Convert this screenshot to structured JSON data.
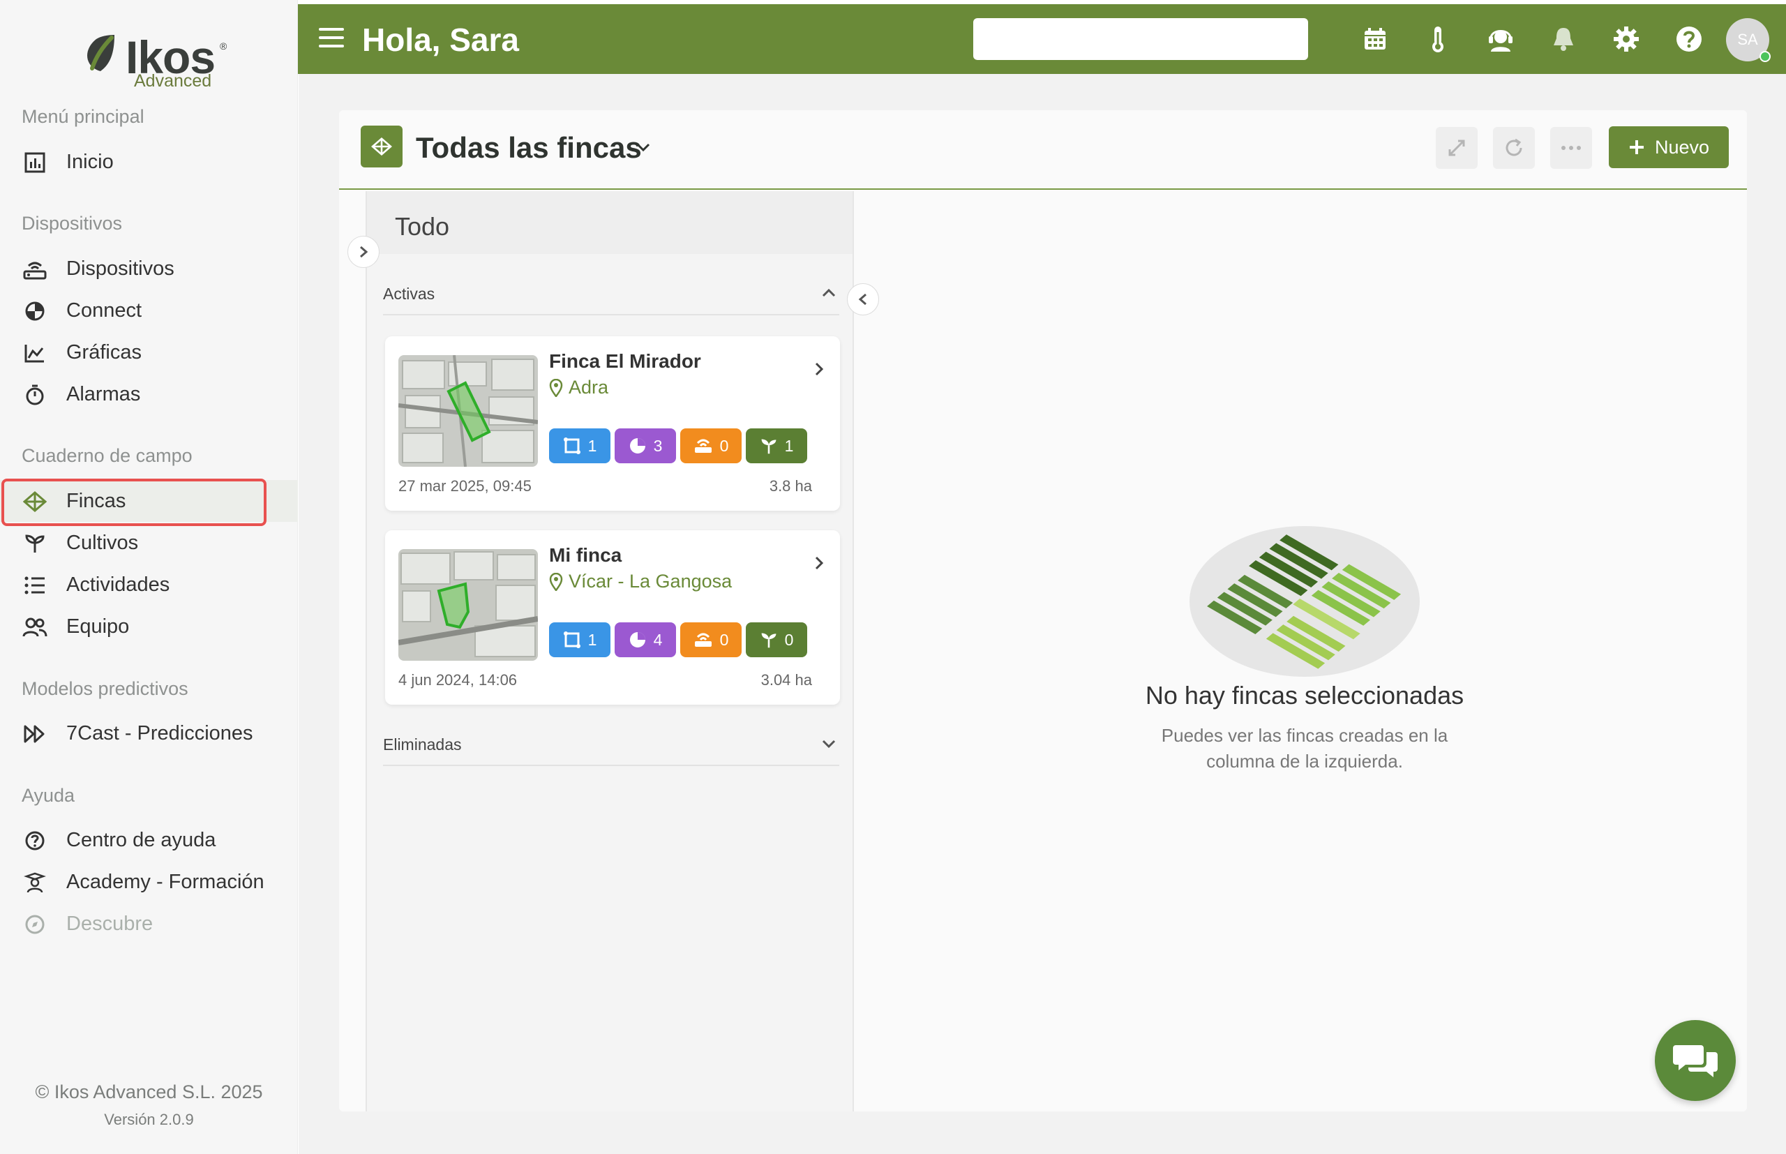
{
  "brand": {
    "name": "Ikos",
    "sub": "Advanced",
    "reg": "®",
    "accent": "#6a8a38",
    "highlight": "#e8514f"
  },
  "header": {
    "greeting": "Hola, Sara",
    "search_placeholder": "",
    "avatar_initials": "SA",
    "icons": [
      "calendar-icon",
      "thermometer-icon",
      "support-agent-icon",
      "bell-icon",
      "gear-icon",
      "help-icon"
    ]
  },
  "sidebar": {
    "sections": {
      "main": "Menú principal",
      "devices": "Dispositivos",
      "fieldbook": "Cuaderno de campo",
      "predictive": "Modelos predictivos",
      "help": "Ayuda"
    },
    "items": {
      "inicio": "Inicio",
      "dispositivos": "Dispositivos",
      "connect": "Connect",
      "graficas": "Gráficas",
      "alarmas": "Alarmas",
      "fincas": "Fincas",
      "cultivos": "Cultivos",
      "actividades": "Actividades",
      "equipo": "Equipo",
      "sevencast": "7Cast - Predicciones",
      "centro": "Centro de ayuda",
      "academy": "Academy - Formación",
      "descubre": "Descubre"
    },
    "active_item": "Fincas",
    "footer": {
      "copyright": "© Ikos Advanced S.L. 2025",
      "version": "Versión 2.0.9"
    }
  },
  "panel": {
    "title": "Todas las fincas",
    "new_button": "Nuevo",
    "list_title": "Todo",
    "group_active": "Activas",
    "group_deleted": "Eliminadas",
    "farms": [
      {
        "name": "Finca El Mirador",
        "location": "Adra",
        "badges": {
          "fields": "1",
          "sectors": "3",
          "devices": "0",
          "crops": "1"
        },
        "date": "27 mar 2025, 09:45",
        "area": "3.8 ha"
      },
      {
        "name": "Mi finca",
        "location": "Vícar - La Gangosa",
        "badges": {
          "fields": "1",
          "sectors": "4",
          "devices": "0",
          "crops": "0"
        },
        "date": "4 jun 2024, 14:06",
        "area": "3.04 ha"
      }
    ],
    "empty": {
      "title": "No hay fincas seleccionadas",
      "subtitle_line1": "Puedes ver las fincas creadas en la",
      "subtitle_line2": "columna de la izquierda."
    }
  }
}
